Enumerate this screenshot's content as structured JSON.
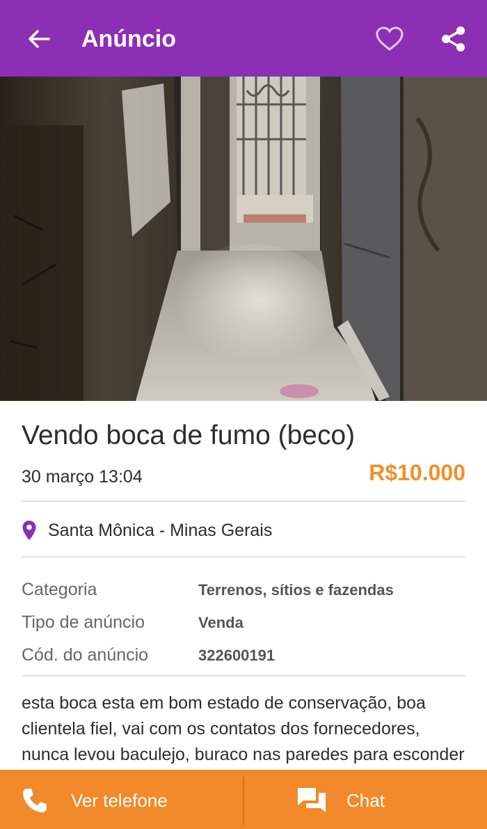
{
  "appbar": {
    "title": "Anúncio",
    "back_icon": "arrow-left-icon",
    "favorite_icon": "heart-outline-icon",
    "share_icon": "share-icon",
    "background_color": "#8c2fb5"
  },
  "photo": {
    "alt": "alley photo"
  },
  "ad": {
    "title": "Vendo boca de fumo (beco)",
    "date": "30 março 13:04",
    "price": "R$10.000",
    "price_color": "#f0912b",
    "location": "Santa Mônica - Minas Gerais",
    "location_icon": "map-pin-icon"
  },
  "details": [
    {
      "label": "Categoria",
      "value": "Terrenos, sítios e fazendas"
    },
    {
      "label": "Tipo de anúncio",
      "value": "Venda"
    },
    {
      "label": "Cód. do anúncio",
      "value": "322600191"
    }
  ],
  "description": "esta boca esta em bom estado de conservação, boa clientela fiel, vai com os contatos dos fornecedores, nunca levou baculejo, buraco nas paredes para esconder os bagulho, muro pequeno ao lado para",
  "bottombar": {
    "phone_label": "Ver telefone",
    "phone_icon": "phone-icon",
    "chat_label": "Chat",
    "chat_icon": "chat-bubbles-icon",
    "background_color": "#f2892a"
  }
}
